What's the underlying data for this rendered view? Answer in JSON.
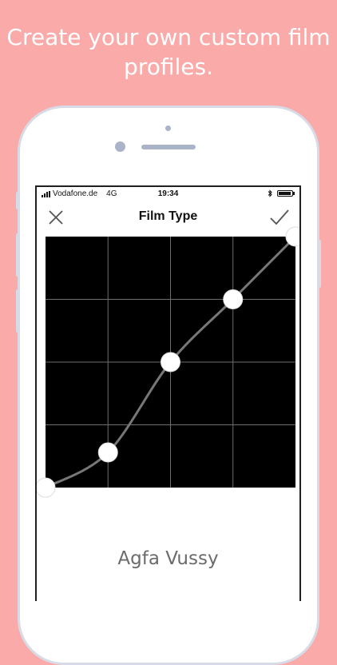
{
  "headline": "Create your own custom film profiles.",
  "status_bar": {
    "carrier": "Vodafone.de",
    "network": "4G",
    "time": "19:34"
  },
  "nav": {
    "title": "Film Type",
    "close_icon": "close-icon",
    "done_icon": "checkmark-icon"
  },
  "curve": {
    "grid_divisions": 4,
    "grid_color": "#6e6e6e",
    "curve_color": "#777777",
    "handle_color": "#ffffff",
    "background": "#000000",
    "points": [
      {
        "x": 0.0,
        "y": 0.0
      },
      {
        "x": 0.25,
        "y": 0.14
      },
      {
        "x": 0.5,
        "y": 0.5
      },
      {
        "x": 0.75,
        "y": 0.75
      },
      {
        "x": 1.0,
        "y": 1.0
      }
    ]
  },
  "film_name": "Agfa Vussy",
  "colors": {
    "background": "#fbaaaa",
    "phone_frame": "#d7dbe6"
  }
}
